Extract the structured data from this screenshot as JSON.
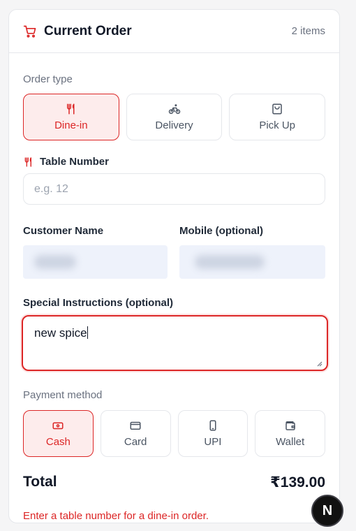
{
  "header": {
    "title": "Current Order",
    "item_count": "2 items"
  },
  "order_type": {
    "label": "Order type",
    "options": [
      {
        "label": "Dine-in",
        "icon": "utensils-icon",
        "active": true
      },
      {
        "label": "Delivery",
        "icon": "bicycle-icon",
        "active": false
      },
      {
        "label": "Pick Up",
        "icon": "shopping-bag-icon",
        "active": false
      }
    ]
  },
  "table_number": {
    "label": "Table Number",
    "placeholder": "e.g. 12",
    "value": ""
  },
  "customer": {
    "name_label": "Customer Name",
    "mobile_label": "Mobile (optional)"
  },
  "instructions": {
    "label": "Special Instructions (optional)",
    "value": "new spice"
  },
  "payment": {
    "label": "Payment method",
    "options": [
      {
        "label": "Cash",
        "icon": "cash-icon",
        "active": true
      },
      {
        "label": "Card",
        "icon": "card-icon",
        "active": false
      },
      {
        "label": "UPI",
        "icon": "phone-icon",
        "active": false
      },
      {
        "label": "Wallet",
        "icon": "wallet-icon",
        "active": false
      }
    ]
  },
  "total": {
    "label": "Total",
    "value": "₹139.00"
  },
  "error": "Enter a table number for a dine-in order.",
  "fab": {
    "label": "N"
  },
  "colors": {
    "accent": "#dc2626",
    "accent_bg": "#fdecec"
  }
}
